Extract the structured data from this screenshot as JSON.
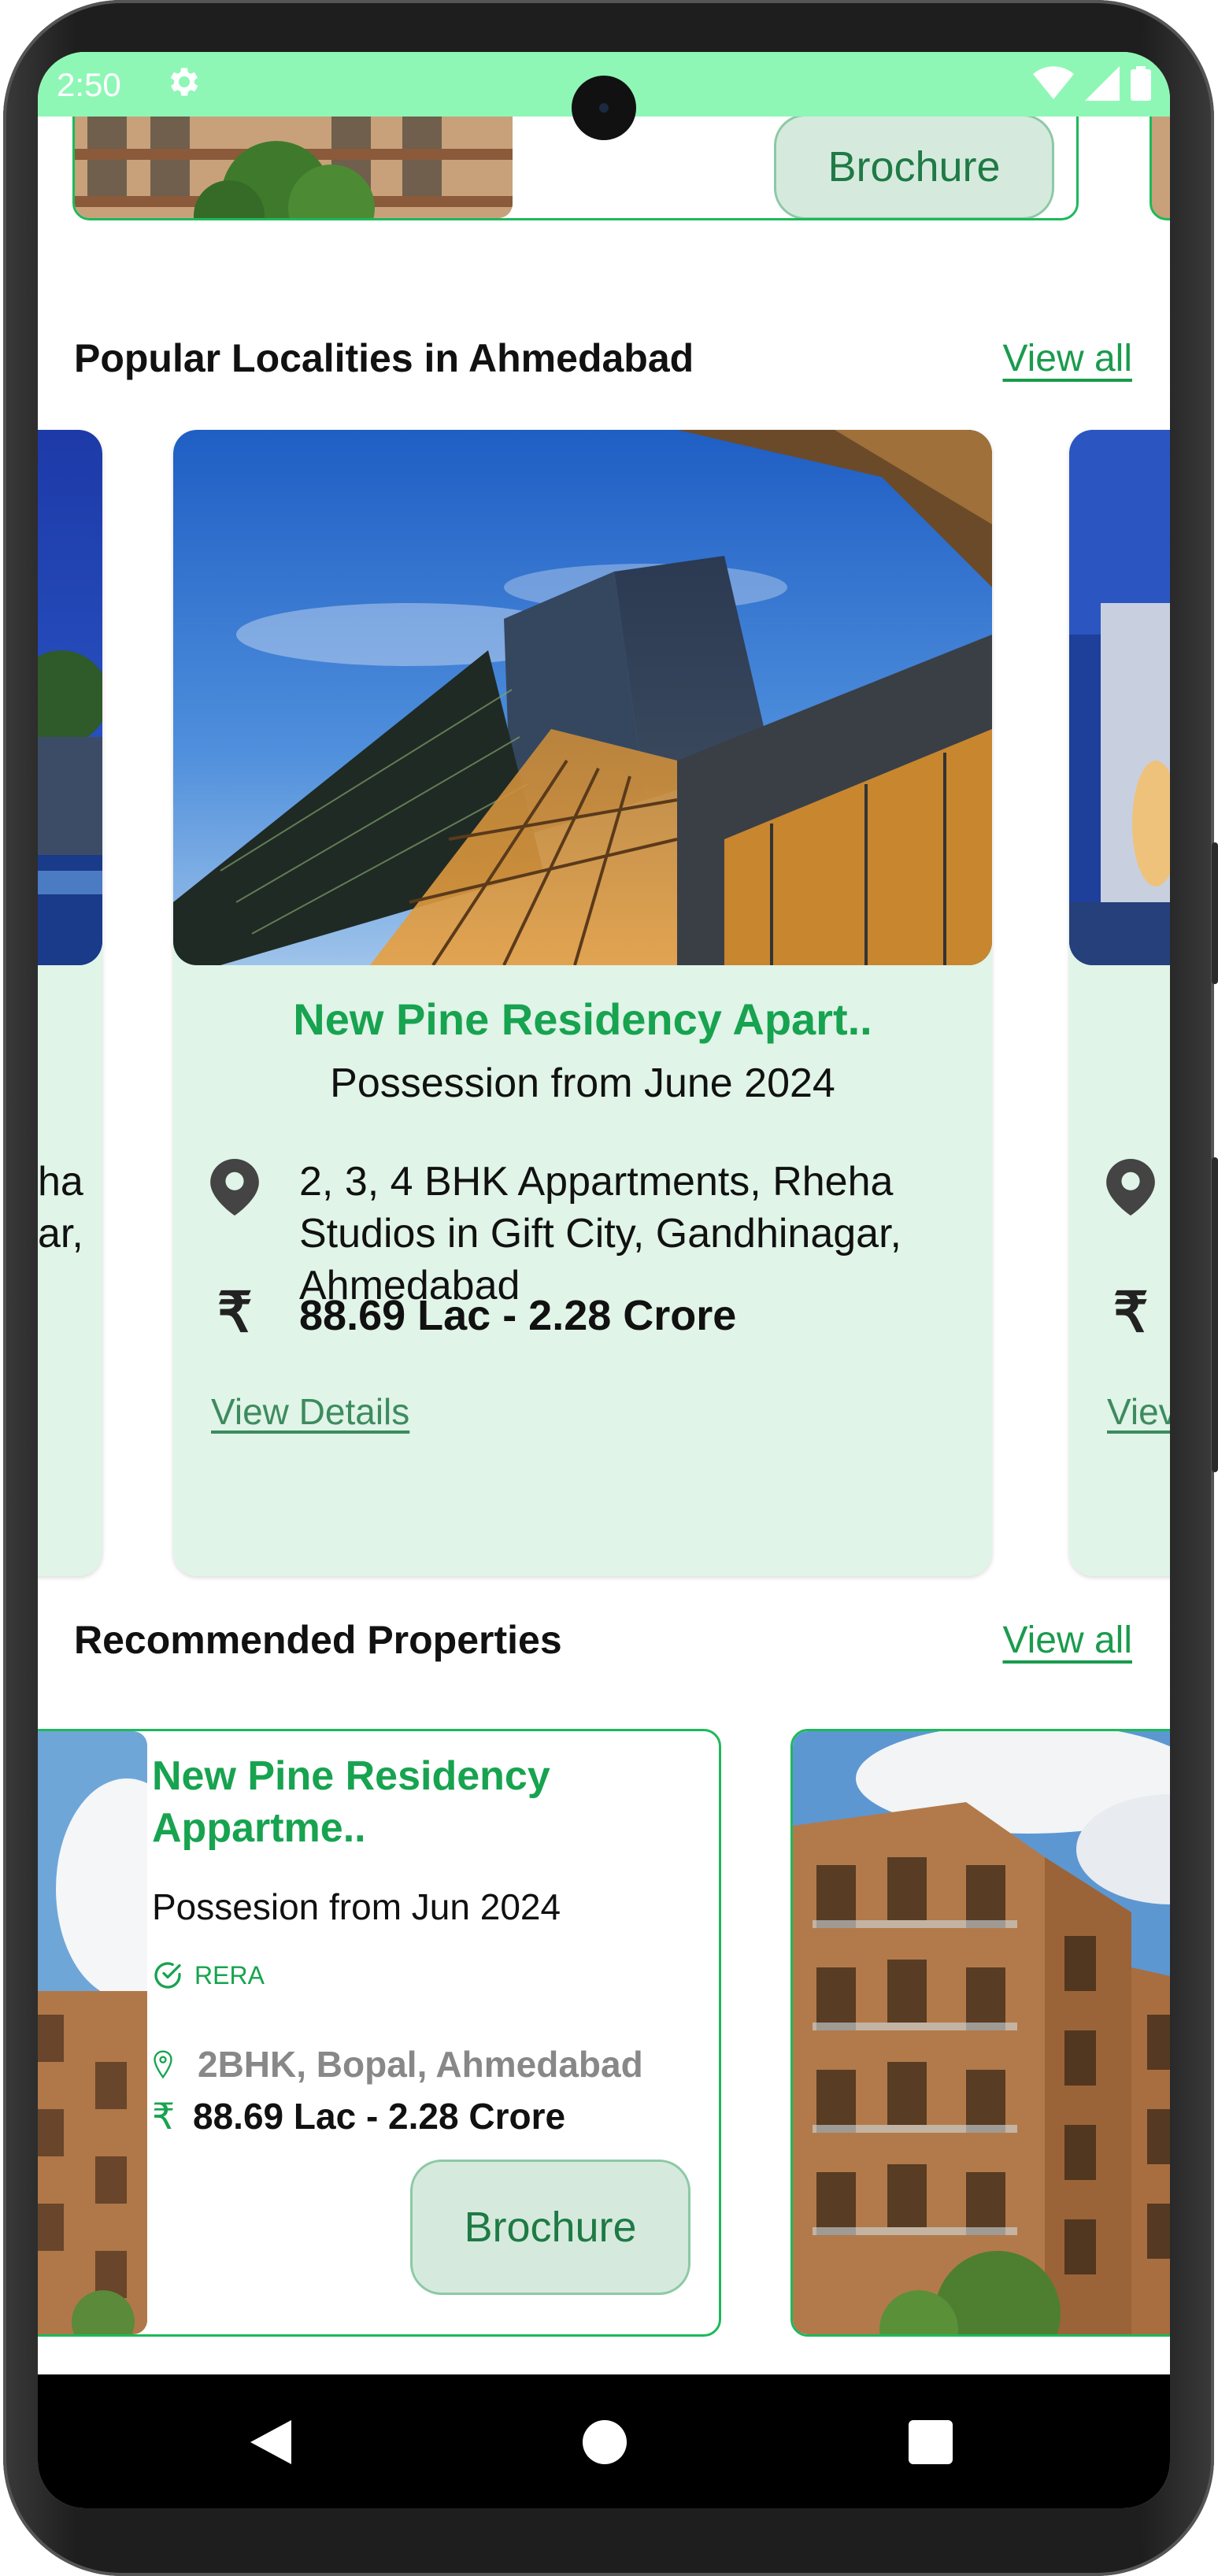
{
  "status_bar": {
    "time": "2:50"
  },
  "top_card": {
    "brochure_label": "Brochure"
  },
  "localities": {
    "title": "Popular Localities in Ahmedabad",
    "view_all": "View all",
    "left_partial": {
      "addr_line1": "ha",
      "addr_line2": "ar,"
    },
    "card": {
      "title": "New Pine Residency Apart..",
      "subtitle": "Possession from June 2024",
      "address": "2, 3, 4 BHK Appartments, Rheha Studios in Gift City, Gandhinagar, Ahmedabad",
      "rupee": "₹",
      "price": "88.69 Lac - 2.28 Crore",
      "view_details": "View Details"
    },
    "right_partial": {
      "rupee": "₹",
      "view_details": "Viev"
    }
  },
  "recommended": {
    "title": "Recommended Properties",
    "view_all": "View all",
    "card": {
      "title": "New Pine Residency Appartme..",
      "subtitle": "Possesion from Jun 2024",
      "rera": "RERA",
      "location": "2BHK, Bopal, Ahmedabad",
      "rupee": "₹",
      "price": "88.69 Lac - 2.28 Crore",
      "brochure_label": "Brochure"
    }
  },
  "colors": {
    "accent": "#17a34f",
    "status_bar": "#8ef7b6",
    "card_bg": "#e0f4e8"
  }
}
